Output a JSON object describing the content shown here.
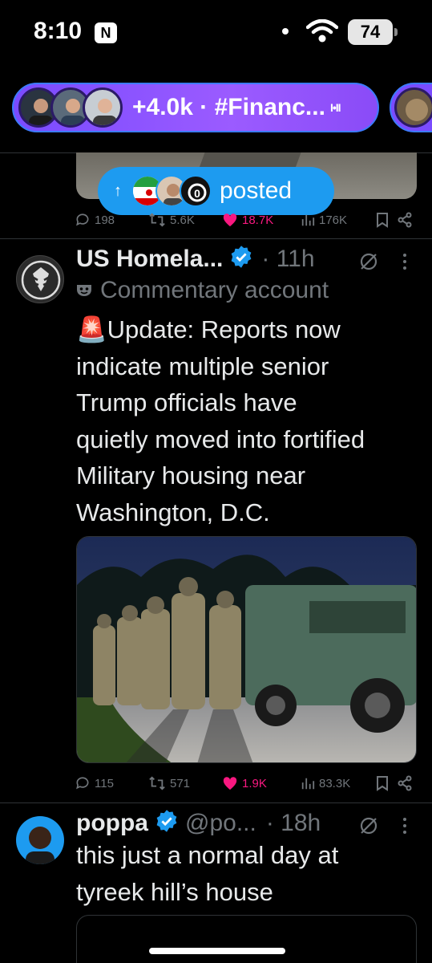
{
  "status_bar": {
    "time": "8:10",
    "app_badge": "N",
    "battery": "74"
  },
  "spaces": {
    "label": "+4.0k · #Financ...",
    "bars": "I•II"
  },
  "feed_notice": {
    "label": "posted",
    "arrow": "↑"
  },
  "prev_tweet": {
    "stats": {
      "replies": "198",
      "retweets": "5.6K",
      "likes": "18.7K",
      "views": "176K"
    }
  },
  "tweet1": {
    "name": "US Homela...",
    "time": "· 11h",
    "commentary": "Commentary account",
    "text": "🚨Update: Reports now indicate multiple senior Trump officials have quietly moved into fortified Military housing near Washington, D.C.",
    "lines": [
      "🚨Update: Reports now",
      "indicate multiple senior",
      "Trump officials have",
      "quietly moved into fortified",
      "Military housing near",
      "Washington, D.C."
    ],
    "stats": {
      "replies": "115",
      "retweets": "571",
      "likes": "1.9K",
      "views": "83.3K"
    }
  },
  "tweet2": {
    "name": "poppa",
    "handle": "@po...",
    "time": "· 18h",
    "lines": [
      "this just a normal day at",
      "tyreek hill’s house"
    ]
  },
  "colors": {
    "accent": "#1d9bf0",
    "like": "#f91880",
    "muted": "#71767b",
    "spaces": "#8a54ff"
  }
}
